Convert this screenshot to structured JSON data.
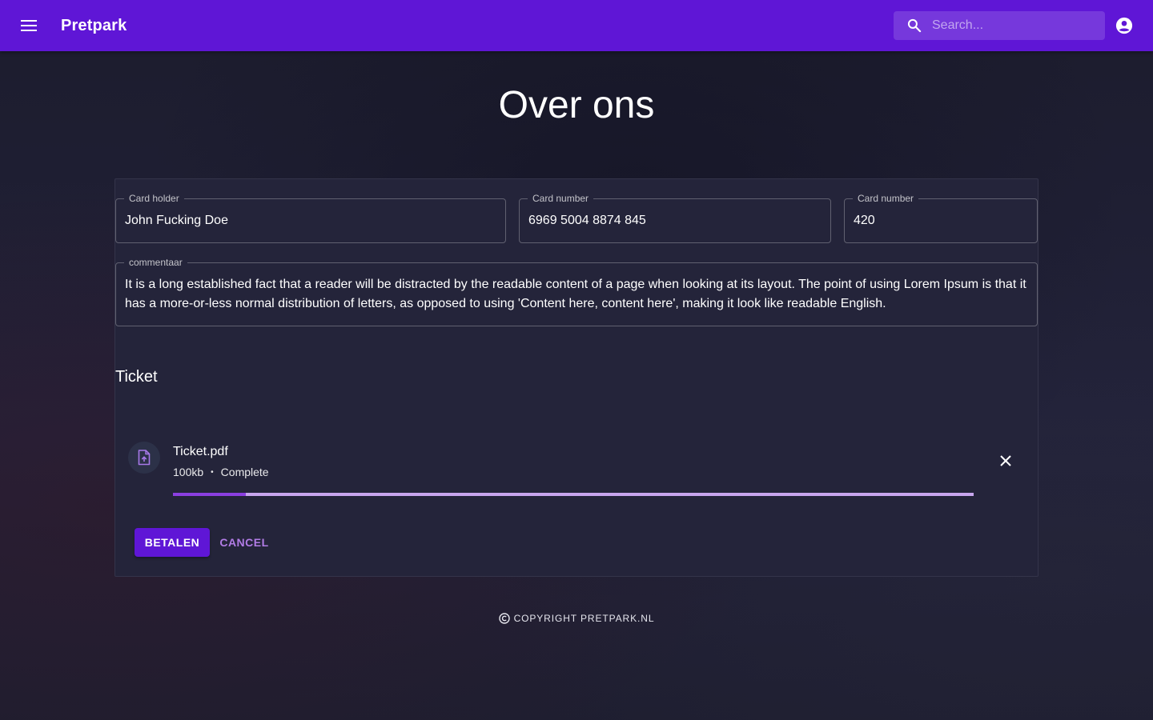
{
  "appbar": {
    "title": "Pretpark",
    "menu_icon": "menu-icon",
    "search_placeholder": "Search...",
    "search_icon": "search-icon",
    "account_icon": "account-circle-icon",
    "color": "#5f16d6"
  },
  "page": {
    "title": "Over ons"
  },
  "form": {
    "card_holder": {
      "label": "Card holder",
      "value": "John Fucking Doe"
    },
    "card_number": {
      "label": "Card number",
      "value": "6969 5004 8874 845"
    },
    "card_cvc": {
      "label": "Card number",
      "value": "420"
    },
    "comment": {
      "label": "commentaar",
      "value": "It is a long established fact that a reader will be distracted by the readable content of a page when looking at its layout. The point of using Lorem Ipsum is that it has a more-or-less normal distribution of letters, as opposed to using 'Content here, content here', making it look like readable English."
    }
  },
  "ticket": {
    "section_title": "Ticket",
    "file_icon": "file-upload-icon",
    "file_name": "Ticket.pdf",
    "file_size": "100kb",
    "separator": "•",
    "status": "Complete",
    "progress_fraction": 0.091,
    "close_icon": "close-icon"
  },
  "actions": {
    "pay_label": "BETALEN",
    "cancel_label": "CANCEL"
  },
  "footer": {
    "icon": "copyright-icon",
    "text": "COPYRIGHT PRETPARK.NL"
  }
}
